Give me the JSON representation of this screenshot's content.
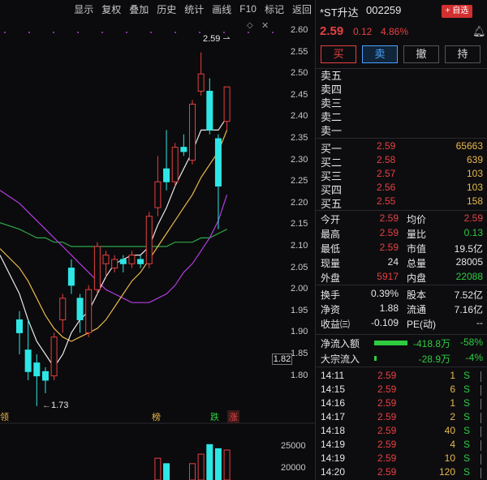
{
  "toolbar": {
    "items": [
      "显示",
      "复权",
      "叠加",
      "历史",
      "统计",
      "画线",
      "F10",
      "标记",
      "返回"
    ]
  },
  "price_axis": [
    "2.60",
    "2.55",
    "2.50",
    "2.45",
    "2.40",
    "2.35",
    "2.30",
    "2.25",
    "2.20",
    "2.15",
    "2.10",
    "2.05",
    "2.00",
    "1.95",
    "1.90",
    "1.85",
    "1.80"
  ],
  "cursor_value": "1.82",
  "annotations": {
    "high": "2.59",
    "low": "1.73"
  },
  "markers": {
    "left": "领",
    "bang": "榜",
    "die": "跌",
    "zhang": "涨"
  },
  "volume_axis": [
    "25000",
    "20000"
  ],
  "colors": {
    "up": "#e74040",
    "down": "#2ee6e6",
    "ma5": "#e8e8e8",
    "ma10": "#e8b84a",
    "ma20": "#b43ce0",
    "ma60": "#2ea84a"
  },
  "candles": [
    {
      "o": 1.93,
      "c": 1.9,
      "h": 1.95,
      "l": 1.85
    },
    {
      "o": 1.86,
      "c": 1.81,
      "h": 1.93,
      "l": 1.79
    },
    {
      "o": 1.83,
      "c": 1.8,
      "h": 1.85,
      "l": 1.73
    },
    {
      "o": 1.81,
      "c": 1.79,
      "h": 1.82,
      "l": 1.76
    },
    {
      "o": 1.8,
      "c": 1.89,
      "h": 1.9,
      "l": 1.79
    },
    {
      "o": 1.93,
      "c": 1.98,
      "h": 1.99,
      "l": 1.9
    },
    {
      "o": 2.05,
      "c": 2.01,
      "h": 2.07,
      "l": 1.99
    },
    {
      "o": 1.98,
      "c": 1.93,
      "h": 1.99,
      "l": 1.9
    },
    {
      "o": 1.9,
      "c": 2.0,
      "h": 2.01,
      "l": 1.89
    },
    {
      "o": 2.0,
      "c": 2.1,
      "h": 2.11,
      "l": 1.99
    },
    {
      "o": 2.06,
      "c": 2.08,
      "h": 2.09,
      "l": 2.03
    },
    {
      "o": 2.05,
      "c": 2.07,
      "h": 2.08,
      "l": 2.04
    },
    {
      "o": 2.07,
      "c": 2.06,
      "h": 2.08,
      "l": 2.04
    },
    {
      "o": 2.06,
      "c": 2.08,
      "h": 2.09,
      "l": 2.05
    },
    {
      "o": 2.07,
      "c": 2.06,
      "h": 2.08,
      "l": 2.05
    },
    {
      "o": 2.06,
      "c": 2.17,
      "h": 2.18,
      "l": 2.05
    },
    {
      "o": 2.19,
      "c": 2.25,
      "h": 2.31,
      "l": 2.17
    },
    {
      "o": 2.28,
      "c": 2.25,
      "h": 2.37,
      "l": 2.23
    },
    {
      "o": 2.25,
      "c": 2.33,
      "h": 2.34,
      "l": 2.24
    },
    {
      "o": 2.33,
      "c": 2.32,
      "h": 2.36,
      "l": 2.31
    },
    {
      "o": 2.3,
      "c": 2.43,
      "h": 2.44,
      "l": 2.29
    },
    {
      "o": 2.46,
      "c": 2.5,
      "h": 2.55,
      "l": 2.45
    },
    {
      "o": 2.46,
      "c": 2.37,
      "h": 2.49,
      "l": 2.36
    },
    {
      "o": 2.35,
      "c": 2.24,
      "h": 2.36,
      "l": 2.14
    },
    {
      "o": 2.39,
      "c": 2.47,
      "h": 2.47,
      "l": 2.37
    }
  ],
  "ma5": [
    1.99,
    1.93,
    1.88,
    1.85,
    1.82,
    1.85,
    1.9,
    1.93,
    1.95,
    1.99,
    2.03,
    2.06,
    2.07,
    2.08,
    2.08,
    2.1,
    2.15,
    2.19,
    2.24,
    2.28,
    2.32,
    2.37,
    2.37,
    2.37,
    2.4
  ],
  "ma10": [
    2.05,
    2.02,
    1.98,
    1.94,
    1.91,
    1.89,
    1.88,
    1.89,
    1.9,
    1.91,
    1.93,
    1.96,
    1.99,
    2.02,
    2.04,
    2.07,
    2.1,
    2.13,
    2.16,
    2.19,
    2.22,
    2.26,
    2.29,
    2.32,
    2.37
  ],
  "ma20": [
    2.2,
    2.18,
    2.16,
    2.14,
    2.12,
    2.1,
    2.08,
    2.06,
    2.04,
    2.02,
    2.0,
    1.99,
    1.98,
    1.97,
    1.97,
    1.97,
    1.98,
    1.99,
    2.01,
    2.04,
    2.06,
    2.09,
    2.12,
    2.16,
    2.22
  ],
  "ma60": [
    2.14,
    2.13,
    2.12,
    2.12,
    2.11,
    2.11,
    2.1,
    2.1,
    2.1,
    2.1,
    2.1,
    2.1,
    2.1,
    2.1,
    2.1,
    2.1,
    2.1,
    2.1,
    2.11,
    2.11,
    2.11,
    2.12,
    2.12,
    2.13,
    2.14
  ],
  "volumes": [
    0,
    0,
    0,
    0,
    0,
    0,
    0,
    0,
    0,
    0,
    0,
    0,
    0,
    0,
    0,
    0,
    16000,
    12000,
    0,
    0,
    12000,
    19000,
    26000,
    23000,
    22000
  ],
  "stock": {
    "name": "*ST升达",
    "code": "002259",
    "add_label": "+ 自选",
    "price": "2.59",
    "change": "0.12",
    "pct": "4.86%"
  },
  "actions": {
    "buy": "买",
    "sell": "卖",
    "cancel": "撤",
    "hold": "持"
  },
  "asks": [
    {
      "label": "卖五",
      "price": "",
      "vol": ""
    },
    {
      "label": "卖四",
      "price": "",
      "vol": ""
    },
    {
      "label": "卖三",
      "price": "",
      "vol": ""
    },
    {
      "label": "卖二",
      "price": "",
      "vol": ""
    },
    {
      "label": "卖一",
      "price": "",
      "vol": ""
    }
  ],
  "bids": [
    {
      "label": "买一",
      "price": "2.59",
      "vol": "65663"
    },
    {
      "label": "买二",
      "price": "2.58",
      "vol": "639"
    },
    {
      "label": "买三",
      "price": "2.57",
      "vol": "103"
    },
    {
      "label": "买四",
      "price": "2.56",
      "vol": "103"
    },
    {
      "label": "买五",
      "price": "2.55",
      "vol": "158"
    }
  ],
  "stats": [
    {
      "l1": "今开",
      "v1": "2.59",
      "l2": "均价",
      "v2": "2.59"
    },
    {
      "l1": "最高",
      "v1": "2.59",
      "l2": "量比",
      "v2": "0.13"
    },
    {
      "l1": "最低",
      "v1": "2.59",
      "l2": "市值",
      "v2": "19.5亿"
    },
    {
      "l1": "现量",
      "v1": "24",
      "l2": "总量",
      "v2": "28005"
    },
    {
      "l1": "外盘",
      "v1": "5917",
      "l2": "内盘",
      "v2": "22088"
    }
  ],
  "stats2": [
    {
      "l1": "换手",
      "v1": "0.39%",
      "l2": "股本",
      "v2": "7.52亿"
    },
    {
      "l1": "净资",
      "v1": "1.88",
      "l2": "流通",
      "v2": "7.16亿"
    },
    {
      "l1": "收益㈢",
      "v1": "-0.109",
      "l2": "PE(动)",
      "v2": "--"
    }
  ],
  "flows": [
    {
      "label": "净流入额",
      "value": "-418.8万",
      "pct": "-58%",
      "bar": 0.58
    },
    {
      "label": "大宗流入",
      "value": "-28.9万",
      "pct": "-4%",
      "bar": 0.04
    }
  ],
  "ticks": [
    {
      "time": "14:11",
      "price": "2.59",
      "vol": "1",
      "side": "S"
    },
    {
      "time": "14:15",
      "price": "2.59",
      "vol": "6",
      "side": "S"
    },
    {
      "time": "14:16",
      "price": "2.59",
      "vol": "1",
      "side": "S"
    },
    {
      "time": "14:17",
      "price": "2.59",
      "vol": "2",
      "side": "S"
    },
    {
      "time": "14:18",
      "price": "2.59",
      "vol": "40",
      "side": "S"
    },
    {
      "time": "14:19",
      "price": "2.59",
      "vol": "4",
      "side": "S"
    },
    {
      "time": "14:19",
      "price": "2.59",
      "vol": "10",
      "side": "S"
    },
    {
      "time": "14:20",
      "price": "2.59",
      "vol": "120",
      "side": "S"
    }
  ]
}
